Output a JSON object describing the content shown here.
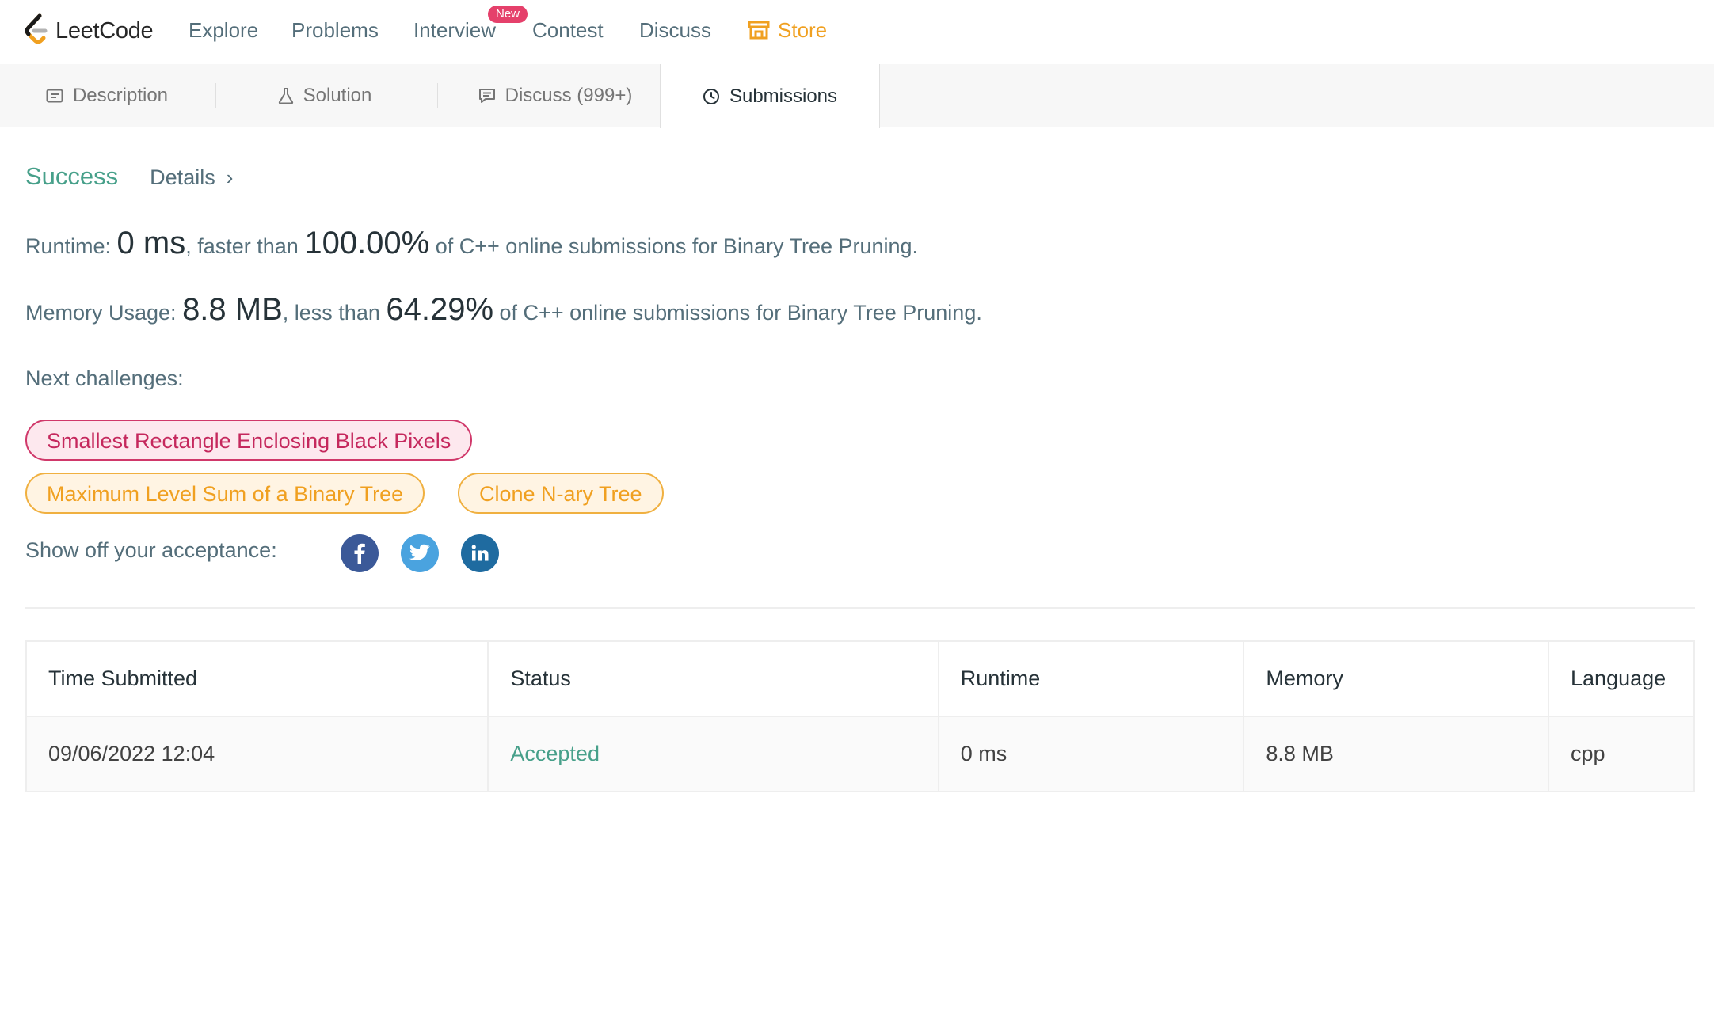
{
  "nav": {
    "logo_text": "LeetCode",
    "items": [
      "Explore",
      "Problems",
      "Interview",
      "Contest",
      "Discuss"
    ],
    "new_badge": "New",
    "store": "Store",
    "store_color": "#f0a020"
  },
  "tabs": [
    {
      "label": "Description",
      "icon": "description-icon"
    },
    {
      "label": "Solution",
      "icon": "flask-icon"
    },
    {
      "label": "Discuss (999+)",
      "icon": "comment-icon"
    },
    {
      "label": "Submissions",
      "icon": "clock-icon",
      "active": true
    }
  ],
  "result": {
    "status": "Success",
    "status_color": "#47a08a",
    "details_label": "Details",
    "runtime": {
      "label": "Runtime: ",
      "value": "0 ms",
      "mid": ", faster than ",
      "percent": "100.00%",
      "tail": " of C++ online submissions for Binary Tree Pruning."
    },
    "memory": {
      "label": "Memory Usage: ",
      "value": "8.8 MB",
      "mid": ", less than ",
      "percent": "64.29%",
      "tail": " of C++ online submissions for Binary Tree Pruning."
    }
  },
  "next_challenges": {
    "label": "Next challenges:",
    "items": [
      {
        "title": "Smallest Rectangle Enclosing Black Pixels",
        "difficulty_color": "#c5285d"
      },
      {
        "title": "Maximum Level Sum of a Binary Tree",
        "difficulty_color": "#f0a020"
      },
      {
        "title": "Clone N-ary Tree",
        "difficulty_color": "#f0a020"
      }
    ]
  },
  "share": {
    "label": "Show off your acceptance:",
    "networks": [
      "facebook-icon",
      "twitter-icon",
      "linkedin-icon"
    ]
  },
  "table": {
    "headers": [
      "Time Submitted",
      "Status",
      "Runtime",
      "Memory",
      "Language"
    ],
    "rows": [
      [
        "09/06/2022 12:04",
        "Accepted",
        "0 ms",
        "8.8 MB",
        "cpp"
      ]
    ]
  }
}
